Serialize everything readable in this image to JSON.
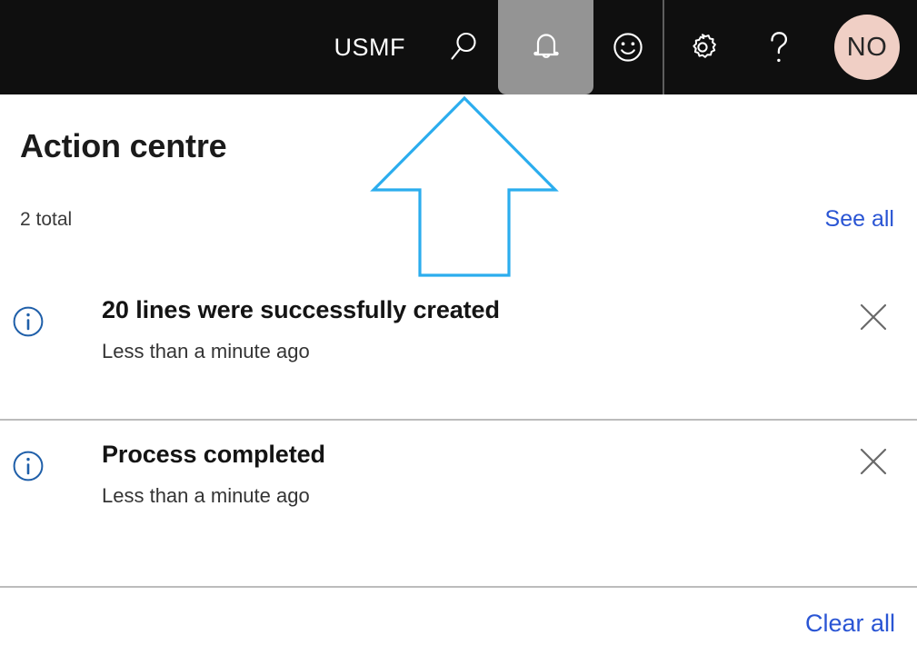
{
  "header": {
    "company_label": "USMF",
    "background_color": "#0f0f0f",
    "active_highlight_color": "#949494",
    "buttons": [
      {
        "name": "search-icon",
        "label": "Search"
      },
      {
        "name": "notifications-icon",
        "label": "Notifications"
      },
      {
        "name": "feedback-smiley-icon",
        "label": "Feedback"
      },
      {
        "name": "settings-gear-icon",
        "label": "Settings"
      },
      {
        "name": "help-question-icon",
        "label": "Help"
      }
    ],
    "avatar": {
      "initials": "NO",
      "background_color": "#f0cfc5",
      "text_color": "#262626"
    }
  },
  "panel": {
    "title": "Action centre",
    "count_label": "2 total",
    "see_all_label": "See all",
    "clear_all_label": "Clear all",
    "link_color": "#2a55d4",
    "info_icon_color": "#1f5fa9",
    "close_icon_color": "#6a6a6a",
    "divider_color": "#bcbcbc",
    "notifications": [
      {
        "icon": "info-circle-icon",
        "title": "20 lines were successfully created",
        "time": "Less than a minute ago",
        "close_label": "Dismiss"
      },
      {
        "icon": "info-circle-icon",
        "title": "Process completed",
        "time": "Less than a minute ago",
        "close_label": "Dismiss"
      }
    ]
  },
  "annotation": {
    "shape": "up-arrow-outline",
    "stroke_color": "#2badee",
    "points_at": "notifications-icon"
  }
}
